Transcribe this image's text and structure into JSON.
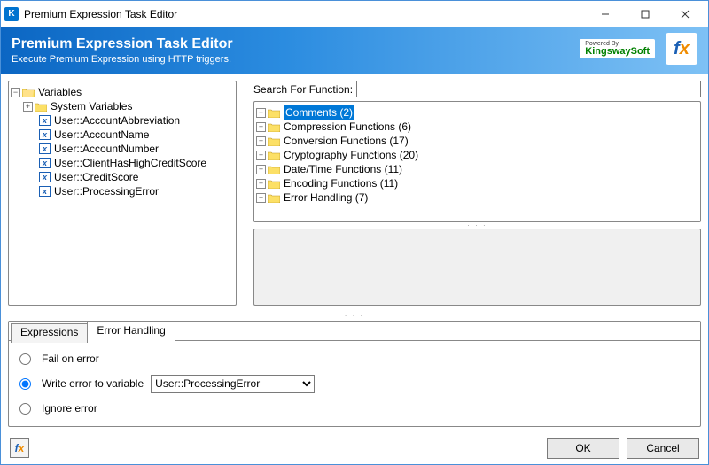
{
  "window": {
    "title": "Premium Expression Task Editor"
  },
  "banner": {
    "title": "Premium Expression Task Editor",
    "subtitle": "Execute Premium Expression using HTTP triggers.",
    "powered_by_small": "Powered By",
    "powered_by": "KingswaySoft",
    "fx": "fx"
  },
  "variables_tree": {
    "root_label": "Variables",
    "children": [
      {
        "label": "System Variables",
        "type": "folder",
        "expandable": true
      },
      {
        "label": "User::AccountAbbreviation",
        "type": "var"
      },
      {
        "label": "User::AccountName",
        "type": "var"
      },
      {
        "label": "User::AccountNumber",
        "type": "var"
      },
      {
        "label": "User::ClientHasHighCreditScore",
        "type": "var"
      },
      {
        "label": "User::CreditScore",
        "type": "var"
      },
      {
        "label": "User::ProcessingError",
        "type": "var"
      }
    ]
  },
  "search": {
    "label": "Search For Function:",
    "value": ""
  },
  "functions_tree": [
    {
      "label": "Comments (2)",
      "selected": true,
      "count": 2
    },
    {
      "label": "Compression Functions (6)",
      "count": 6
    },
    {
      "label": "Conversion Functions (17)",
      "count": 17
    },
    {
      "label": "Cryptography Functions (20)",
      "count": 20
    },
    {
      "label": "Date/Time Functions (11)",
      "count": 11
    },
    {
      "label": "Encoding Functions (11)",
      "count": 11
    },
    {
      "label": "Error Handling (7)",
      "count": 7
    }
  ],
  "tabs": {
    "items": [
      {
        "label": "Expressions",
        "active": false
      },
      {
        "label": "Error Handling",
        "active": true
      }
    ]
  },
  "error_handling": {
    "fail_label": "Fail on error",
    "write_label": "Write error to variable",
    "ignore_label": "Ignore error",
    "selected": "write",
    "variable_options": [
      "User::ProcessingError"
    ],
    "variable_selected": "User::ProcessingError"
  },
  "footer": {
    "fx_label": "fx",
    "ok": "OK",
    "cancel": "Cancel"
  }
}
